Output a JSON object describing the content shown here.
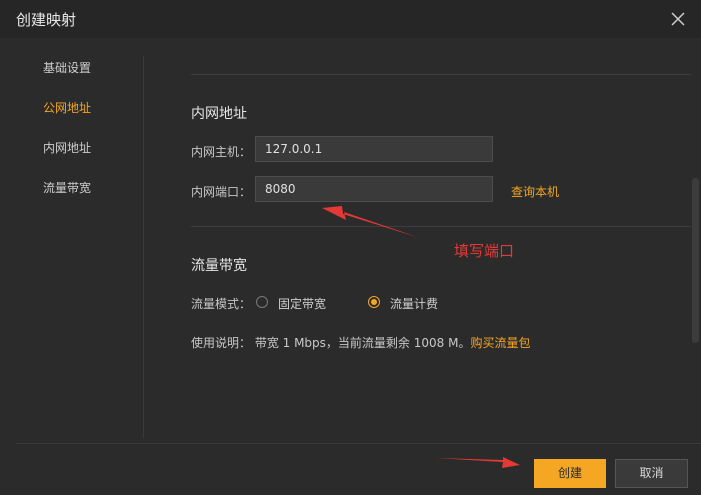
{
  "dialog": {
    "title": "创建映射"
  },
  "sidebar": {
    "items": [
      {
        "label": "基础设置",
        "active": false
      },
      {
        "label": "公网地址",
        "active": true
      },
      {
        "label": "内网地址",
        "active": false
      },
      {
        "label": "流量带宽",
        "active": false
      }
    ]
  },
  "intranet": {
    "heading": "内网地址",
    "host_label": "内网主机：",
    "host_value": "127.0.0.1",
    "port_label": "内网端口：",
    "port_value": "8080",
    "query_link": "查询本机"
  },
  "bandwidth": {
    "heading": "流量带宽",
    "mode_label": "流量模式：",
    "options": [
      {
        "label": "固定带宽",
        "checked": false
      },
      {
        "label": "流量计费",
        "checked": true
      }
    ],
    "note_text": "使用说明：  带宽 1 Mbps，当前流量剩余 1008 M。",
    "buy_link": "购买流量包"
  },
  "footer": {
    "create_label": "创建",
    "cancel_label": "取消"
  },
  "annotation": {
    "text": "填写端口"
  },
  "colors": {
    "accent": "#f5a623",
    "background": "#2b2b2b",
    "annotation_red": "#e53935"
  }
}
